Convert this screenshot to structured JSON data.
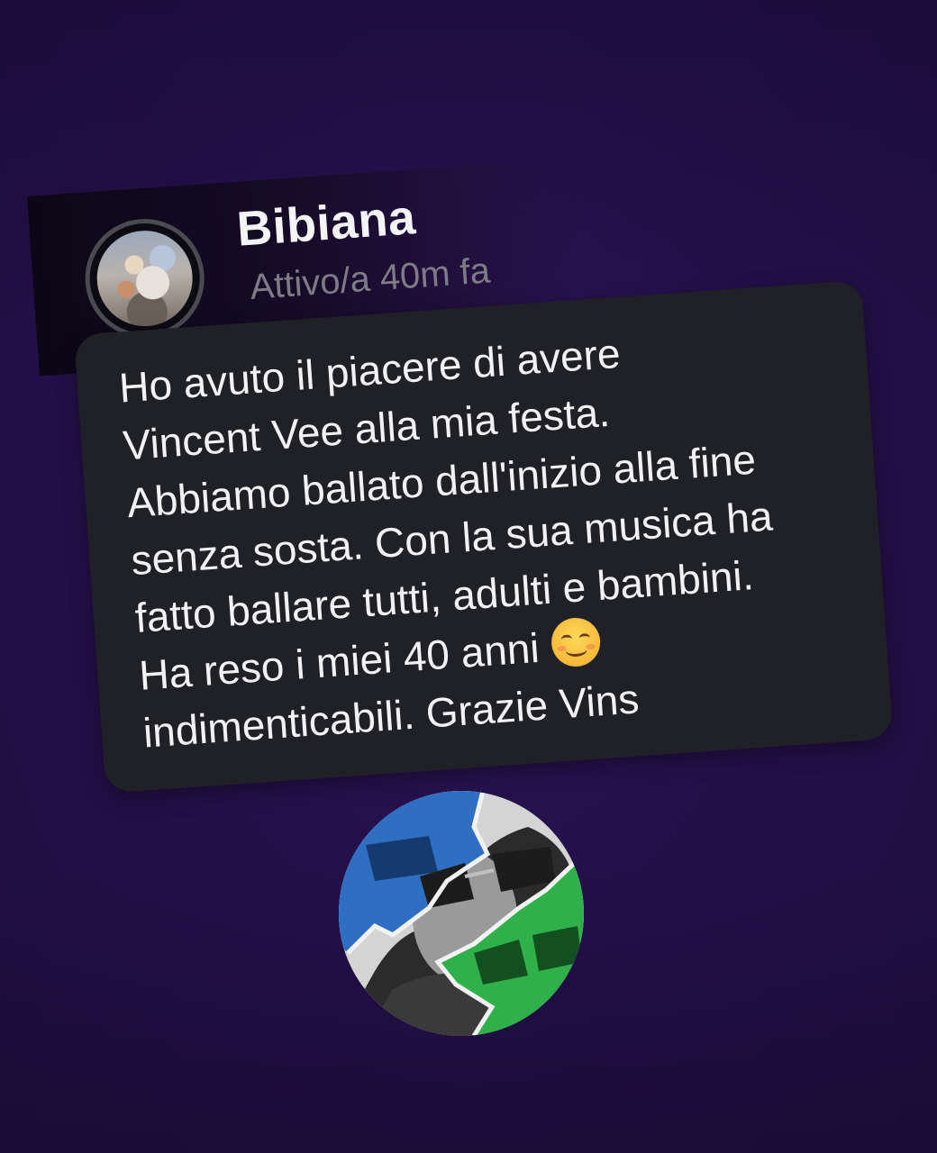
{
  "chat": {
    "contact_name": "Bibiana",
    "status": "Attivo/a 40m fa",
    "avatar_icon": "profile-photo"
  },
  "message": {
    "lines": [
      "Ho avuto il piacere di avere",
      "Vincent Vee alla mia festa.",
      "Abbiamo ballato dall'inizio alla fine",
      "senza sosta. Con la sua musica ha",
      "fatto ballare tutti, adulti e bambini.",
      "Ha reso i miei 40 anni",
      "indimenticabili. Grazie Vins"
    ],
    "emoji_icon": "smiling-face-icon"
  },
  "logo": {
    "icon": "dj-portrait-logo",
    "colors": [
      "#2e6fc4",
      "#2fb04a",
      "#d9d9d9"
    ]
  },
  "colors": {
    "background": "#24104a",
    "bubble": "#202127",
    "text": "#f2f2f4",
    "status_text": "#7d7c86"
  }
}
